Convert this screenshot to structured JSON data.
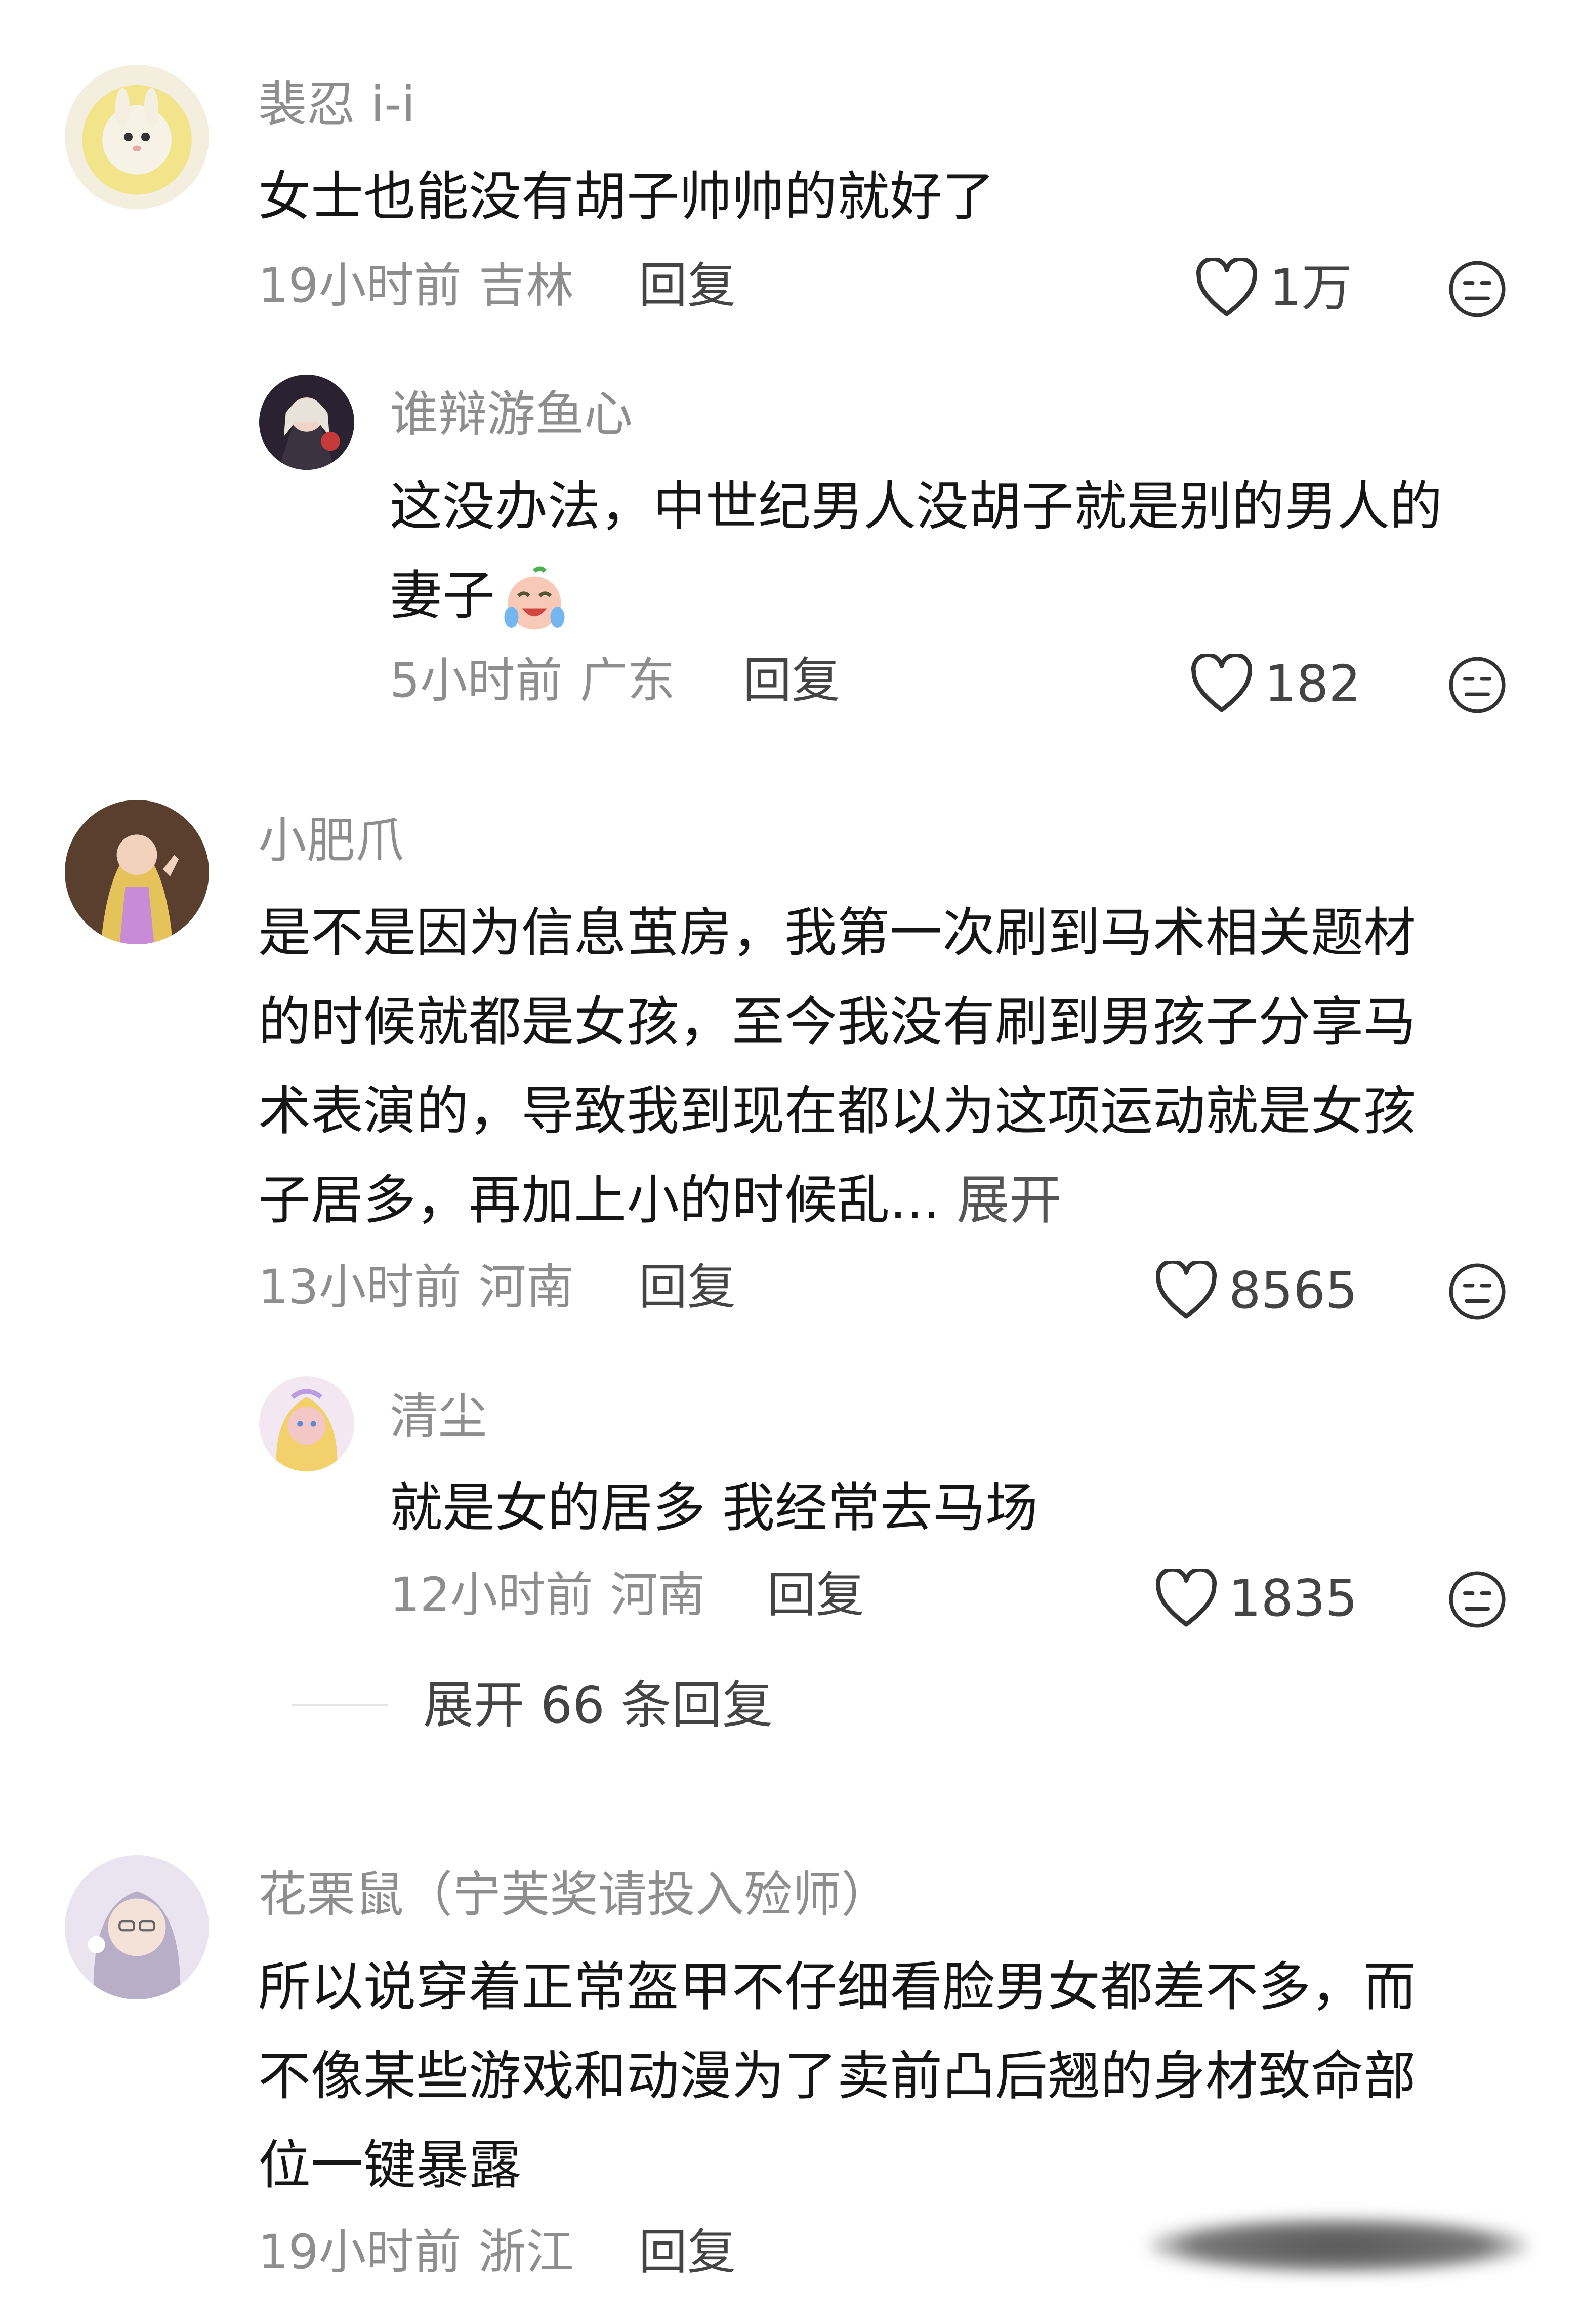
{
  "comments": [
    {
      "username": "裴忍 i-i",
      "text": "女士也能没有胡子帅帅的就好了",
      "time": "19小时前",
      "location": "吉林",
      "reply_label": "回复",
      "likes": "1万"
    },
    {
      "username": "谁辩游鱼心",
      "text_line1": "这没办法，中世纪男人没胡子就是别的男人的",
      "text_line2": "妻子",
      "emoji": "crying-laughing-emoji",
      "time": "5小时前",
      "location": "广东",
      "reply_label": "回复",
      "likes": "182"
    },
    {
      "username": "小肥爪",
      "lines": [
        "是不是因为信息茧房，我第一次刷到马术相关题材",
        "的时候就都是女孩，至今我没有刷到男孩子分享马",
        "术表演的，导致我到现在都以为这项运动就是女孩",
        "子居多，再加上小的时候乱... "
      ],
      "expand_label": "展开",
      "time": "13小时前",
      "location": "河南",
      "reply_label": "回复",
      "likes": "8565"
    },
    {
      "username": "清尘",
      "text": "就是女的居多 我经常去马场",
      "time": "12小时前",
      "location": "河南",
      "reply_label": "回复",
      "likes": "1835"
    },
    {
      "username": "花栗鼠（宁芙奖请投入殓师）",
      "lines": [
        "所以说穿着正常盔甲不仔细看脸男女都差不多，而",
        "不像某些游戏和动漫为了卖前凸后翘的身材致命部",
        "位一键暴露"
      ],
      "time": "19小时前",
      "location": "浙江",
      "reply_label": "回复"
    }
  ],
  "expand_replies_label": "展开 66 条回复",
  "icons": {
    "like": "heart-icon",
    "dislike": "dislike-face-icon"
  },
  "colors": {
    "text": "#161616",
    "secondary": "#8e8e8e",
    "action": "#444444",
    "background": "#ffffff"
  }
}
